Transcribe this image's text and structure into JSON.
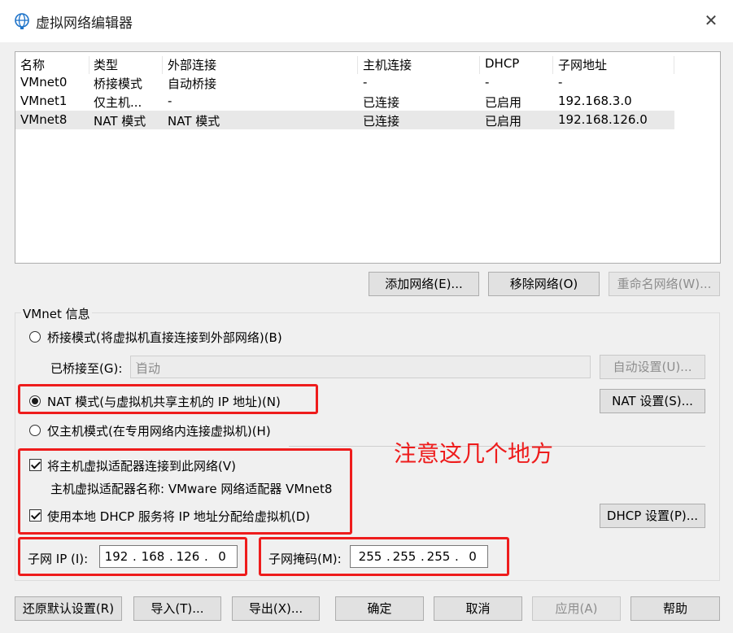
{
  "window": {
    "title": "虚拟网络编辑器",
    "close_glyph": "✕",
    "app_icon": "globe-icon"
  },
  "network_table": {
    "columns": [
      "名称",
      "类型",
      "外部连接",
      "主机连接",
      "DHCP",
      "子网地址"
    ],
    "rows": [
      [
        "VMnet0",
        "桥接模式",
        "自动桥接",
        "-",
        "-",
        "-"
      ],
      [
        "VMnet1",
        "仅主机...",
        "-",
        "已连接",
        "已启用",
        "192.168.3.0"
      ],
      [
        "VMnet8",
        "NAT 模式",
        "NAT 模式",
        "已连接",
        "已启用",
        "192.168.126.0"
      ]
    ],
    "selected_row": 2
  },
  "table_buttons": {
    "add": "添加网络(E)...",
    "remove": "移除网络(O)",
    "rename": "重命名网络(W)..."
  },
  "vmnet_info": {
    "group_label": "VMnet 信息",
    "bridged_label": "桥接模式(将虚拟机直接连接到外部网络)(B)",
    "bridged_to_label": "已桥接至(G):",
    "bridged_to_value": "自动",
    "auto_settings": "自动设置(U)...",
    "nat_label": "NAT 模式(与虚拟机共享主机的 IP 地址)(N)",
    "nat_settings": "NAT 设置(S)...",
    "hostonly_label": "仅主机模式(在专用网络内连接虚拟机)(H)",
    "mode_selected": "nat",
    "connect_adapter_label": "将主机虚拟适配器连接到此网络(V)",
    "connect_adapter_checked": true,
    "adapter_name_label": "主机虚拟适配器名称: VMware 网络适配器 VMnet8",
    "dhcp_label": "使用本地 DHCP 服务将 IP 地址分配给虚拟机(D)",
    "dhcp_checked": true,
    "dhcp_settings": "DHCP 设置(P)...",
    "subnet_ip_label": "子网 IP (I):",
    "subnet_ip": [
      "192",
      "168",
      "126",
      "0"
    ],
    "subnet_mask_label": "子网掩码(M):",
    "subnet_mask": [
      "255",
      "255",
      "255",
      "0"
    ]
  },
  "annotation": {
    "text": "注意这几个地方",
    "color": "#ee1c1c"
  },
  "bottom_buttons": {
    "restore": "还原默认设置(R)",
    "import": "导入(T)...",
    "export": "导出(X)...",
    "ok": "确定",
    "cancel": "取消",
    "apply": "应用(A)",
    "help": "帮助"
  }
}
